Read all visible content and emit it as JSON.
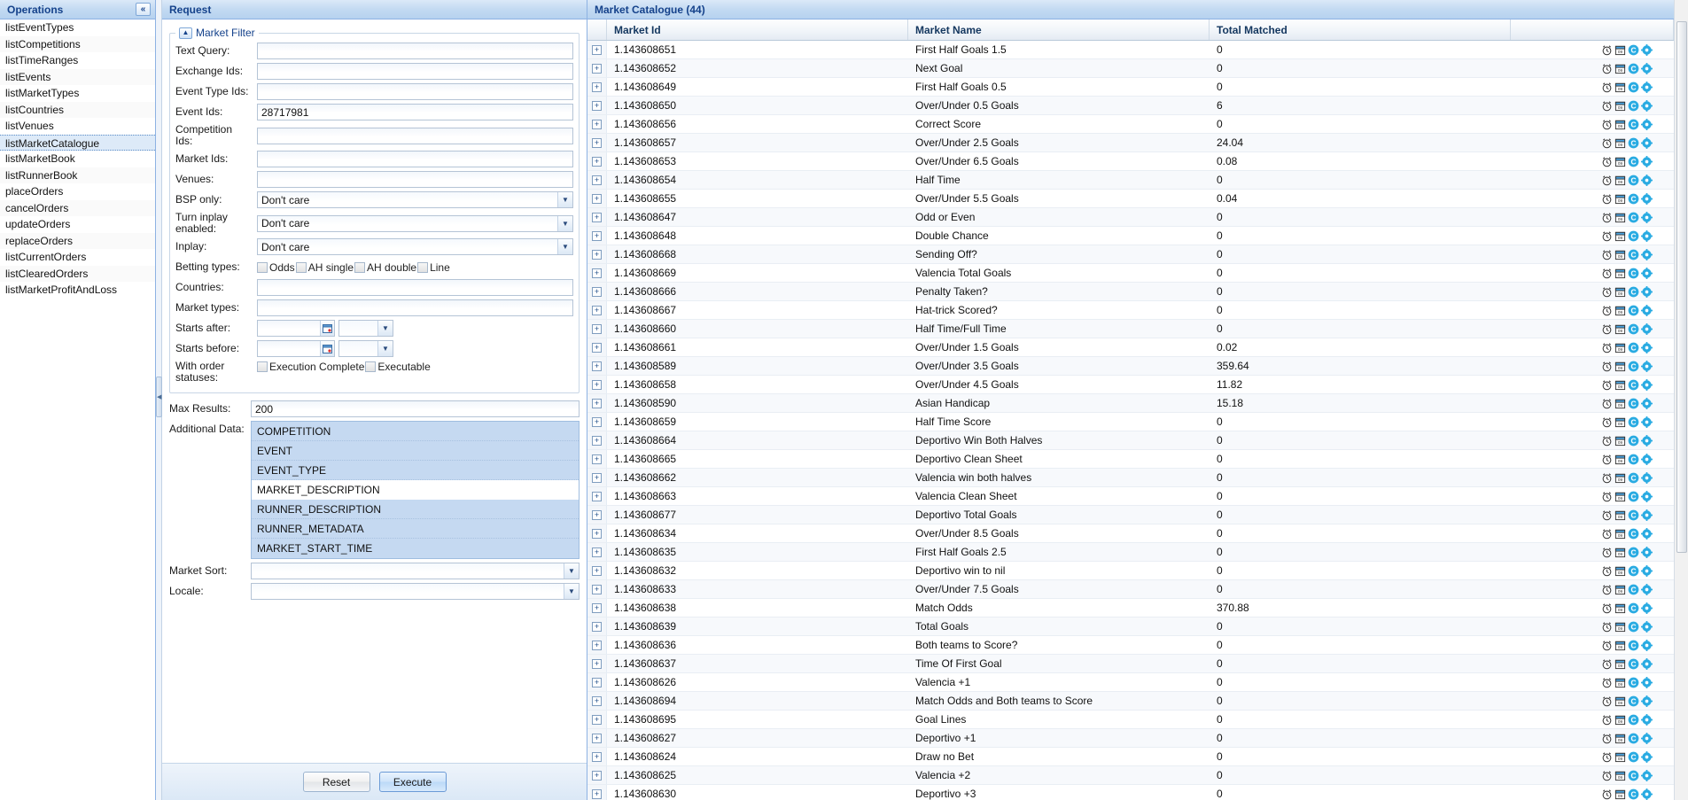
{
  "sidebar": {
    "title": "Operations",
    "collapse_icon": "chevrons-left-icon",
    "items": [
      {
        "label": "listEventTypes",
        "selected": false
      },
      {
        "label": "listCompetitions",
        "selected": false
      },
      {
        "label": "listTimeRanges",
        "selected": false
      },
      {
        "label": "listEvents",
        "selected": false
      },
      {
        "label": "listMarketTypes",
        "selected": false
      },
      {
        "label": "listCountries",
        "selected": false
      },
      {
        "label": "listVenues",
        "selected": false
      },
      {
        "label": "listMarketCatalogue",
        "selected": true
      },
      {
        "label": "listMarketBook",
        "selected": false
      },
      {
        "label": "listRunnerBook",
        "selected": false
      },
      {
        "label": "placeOrders",
        "selected": false
      },
      {
        "label": "cancelOrders",
        "selected": false
      },
      {
        "label": "updateOrders",
        "selected": false
      },
      {
        "label": "replaceOrders",
        "selected": false
      },
      {
        "label": "listCurrentOrders",
        "selected": false
      },
      {
        "label": "listClearedOrders",
        "selected": false
      },
      {
        "label": "listMarketProfitAndLoss",
        "selected": false
      }
    ]
  },
  "request": {
    "title": "Request",
    "filter_legend": "Market Filter",
    "fields": {
      "text_query": {
        "label": "Text Query:",
        "value": ""
      },
      "exchange_ids": {
        "label": "Exchange Ids:",
        "value": ""
      },
      "event_type_ids": {
        "label": "Event Type Ids:",
        "value": ""
      },
      "event_ids": {
        "label": "Event Ids:",
        "value": "28717981"
      },
      "competition_ids": {
        "label": "Competition Ids:",
        "value": ""
      },
      "market_ids": {
        "label": "Market Ids:",
        "value": ""
      },
      "venues": {
        "label": "Venues:",
        "value": ""
      },
      "bsp_only": {
        "label": "BSP only:",
        "value": "Don't care"
      },
      "turn_inplay": {
        "label": "Turn inplay enabled:",
        "value": "Don't care"
      },
      "inplay": {
        "label": "Inplay:",
        "value": "Don't care"
      },
      "betting_types": {
        "label": "Betting types:",
        "options": [
          "Odds",
          "AH single",
          "AH double",
          "Line"
        ]
      },
      "countries": {
        "label": "Countries:",
        "value": ""
      },
      "market_types": {
        "label": "Market types:",
        "value": ""
      },
      "starts_after": {
        "label": "Starts after:",
        "value": "",
        "time": ""
      },
      "starts_before": {
        "label": "Starts before:",
        "value": "",
        "time": ""
      },
      "order_statuses": {
        "label": "With order statuses:",
        "options": [
          "Execution Complete",
          "Executable"
        ]
      },
      "max_results": {
        "label": "Max Results:",
        "value": "200"
      },
      "additional_data": {
        "label": "Additional Data:",
        "items": [
          {
            "label": "COMPETITION",
            "selected": true
          },
          {
            "label": "EVENT",
            "selected": true
          },
          {
            "label": "EVENT_TYPE",
            "selected": true
          },
          {
            "label": "MARKET_DESCRIPTION",
            "selected": false
          },
          {
            "label": "RUNNER_DESCRIPTION",
            "selected": true
          },
          {
            "label": "RUNNER_METADATA",
            "selected": true
          },
          {
            "label": "MARKET_START_TIME",
            "selected": true
          }
        ]
      },
      "market_sort": {
        "label": "Market Sort:",
        "value": ""
      },
      "locale": {
        "label": "Locale:",
        "value": ""
      }
    },
    "buttons": {
      "reset": "Reset",
      "execute": "Execute"
    }
  },
  "results": {
    "title": "Market Catalogue (44)",
    "columns": [
      "",
      "Market Id",
      "Market Name",
      "Total Matched",
      ""
    ],
    "row_icons": [
      "alarm-clock-icon",
      "calendar-icon",
      "chart-c-icon",
      "gear-icon"
    ],
    "expander_icon": "plus-expander-icon",
    "rows": [
      {
        "id": "1.143608651",
        "name": "First Half Goals 1.5",
        "matched": "0"
      },
      {
        "id": "1.143608652",
        "name": "Next Goal",
        "matched": "0"
      },
      {
        "id": "1.143608649",
        "name": "First Half Goals 0.5",
        "matched": "0"
      },
      {
        "id": "1.143608650",
        "name": "Over/Under 0.5 Goals",
        "matched": "6"
      },
      {
        "id": "1.143608656",
        "name": "Correct Score",
        "matched": "0"
      },
      {
        "id": "1.143608657",
        "name": "Over/Under 2.5 Goals",
        "matched": "24.04"
      },
      {
        "id": "1.143608653",
        "name": "Over/Under 6.5 Goals",
        "matched": "0.08"
      },
      {
        "id": "1.143608654",
        "name": "Half Time",
        "matched": "0"
      },
      {
        "id": "1.143608655",
        "name": "Over/Under 5.5 Goals",
        "matched": "0.04"
      },
      {
        "id": "1.143608647",
        "name": "Odd or Even",
        "matched": "0"
      },
      {
        "id": "1.143608648",
        "name": "Double Chance",
        "matched": "0"
      },
      {
        "id": "1.143608668",
        "name": "Sending Off?",
        "matched": "0"
      },
      {
        "id": "1.143608669",
        "name": "Valencia Total Goals",
        "matched": "0"
      },
      {
        "id": "1.143608666",
        "name": "Penalty Taken?",
        "matched": "0"
      },
      {
        "id": "1.143608667",
        "name": "Hat-trick Scored?",
        "matched": "0"
      },
      {
        "id": "1.143608660",
        "name": "Half Time/Full Time",
        "matched": "0"
      },
      {
        "id": "1.143608661",
        "name": "Over/Under 1.5 Goals",
        "matched": "0.02"
      },
      {
        "id": "1.143608589",
        "name": "Over/Under 3.5 Goals",
        "matched": "359.64"
      },
      {
        "id": "1.143608658",
        "name": "Over/Under 4.5 Goals",
        "matched": "11.82"
      },
      {
        "id": "1.143608590",
        "name": "Asian Handicap",
        "matched": "15.18"
      },
      {
        "id": "1.143608659",
        "name": "Half Time Score",
        "matched": "0"
      },
      {
        "id": "1.143608664",
        "name": "Deportivo Win Both Halves",
        "matched": "0"
      },
      {
        "id": "1.143608665",
        "name": "Deportivo Clean Sheet",
        "matched": "0"
      },
      {
        "id": "1.143608662",
        "name": "Valencia win both halves",
        "matched": "0"
      },
      {
        "id": "1.143608663",
        "name": "Valencia Clean Sheet",
        "matched": "0"
      },
      {
        "id": "1.143608677",
        "name": "Deportivo Total Goals",
        "matched": "0"
      },
      {
        "id": "1.143608634",
        "name": "Over/Under 8.5 Goals",
        "matched": "0"
      },
      {
        "id": "1.143608635",
        "name": "First Half Goals 2.5",
        "matched": "0"
      },
      {
        "id": "1.143608632",
        "name": "Deportivo win to nil",
        "matched": "0"
      },
      {
        "id": "1.143608633",
        "name": "Over/Under 7.5 Goals",
        "matched": "0"
      },
      {
        "id": "1.143608638",
        "name": "Match Odds",
        "matched": "370.88"
      },
      {
        "id": "1.143608639",
        "name": "Total Goals",
        "matched": "0"
      },
      {
        "id": "1.143608636",
        "name": "Both teams to Score?",
        "matched": "0"
      },
      {
        "id": "1.143608637",
        "name": "Time Of First Goal",
        "matched": "0"
      },
      {
        "id": "1.143608626",
        "name": "Valencia +1",
        "matched": "0"
      },
      {
        "id": "1.143608694",
        "name": "Match Odds and Both teams to Score",
        "matched": "0"
      },
      {
        "id": "1.143608695",
        "name": "Goal Lines",
        "matched": "0"
      },
      {
        "id": "1.143608627",
        "name": "Deportivo +1",
        "matched": "0"
      },
      {
        "id": "1.143608624",
        "name": "Draw no Bet",
        "matched": "0"
      },
      {
        "id": "1.143608625",
        "name": "Valencia +2",
        "matched": "0"
      },
      {
        "id": "1.143608630",
        "name": "Deportivo +3",
        "matched": "0"
      }
    ]
  },
  "colors": {
    "header_blue": "#15428b",
    "selection_blue": "#c5d9f1",
    "accent_cyan": "#29abe2"
  }
}
